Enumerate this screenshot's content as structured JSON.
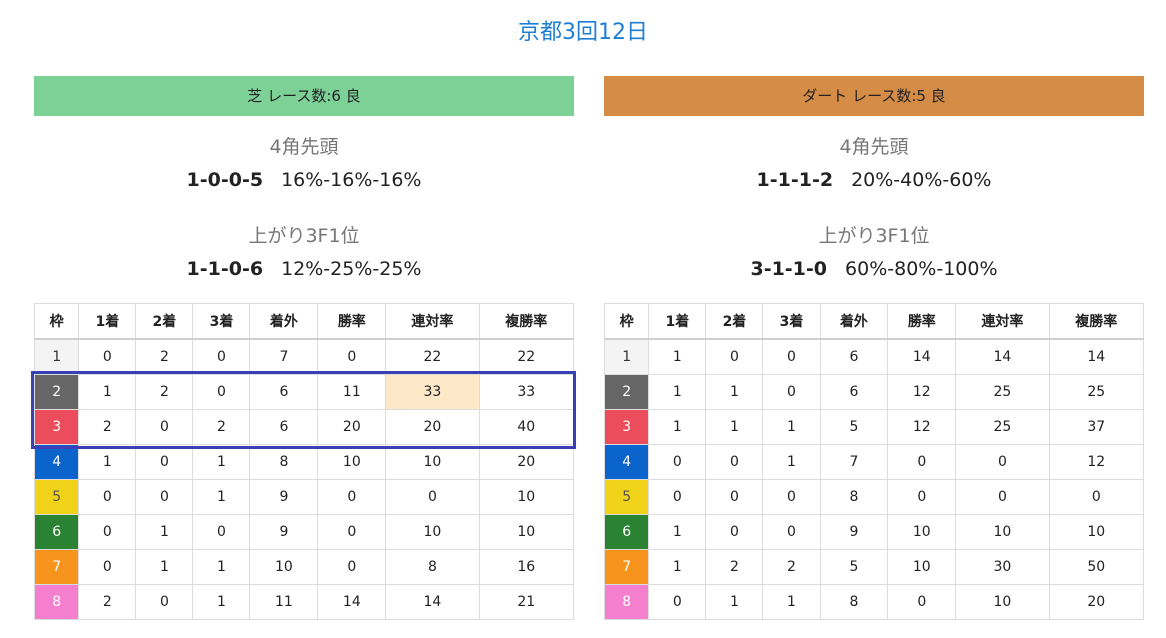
{
  "page_title": "京都3回12日",
  "colors": {
    "title": "#1e7ed4",
    "turf_banner": "#7dd197",
    "dirt_banner": "#d48c46",
    "selection_box": "#3a3fb5",
    "highlight_cell": "#fde9c7"
  },
  "waku_colors": {
    "1": {
      "bg": "#f4f4f4",
      "fg": "#333333"
    },
    "2": {
      "bg": "#666666",
      "fg": "#ffffff"
    },
    "3": {
      "bg": "#eb4d5c",
      "fg": "#ffffff"
    },
    "4": {
      "bg": "#0b63cc",
      "fg": "#ffffff"
    },
    "5": {
      "bg": "#f0d318",
      "fg": "#555555"
    },
    "6": {
      "bg": "#2a8233",
      "fg": "#ffffff"
    },
    "7": {
      "bg": "#f7941d",
      "fg": "#ffffff"
    },
    "8": {
      "bg": "#f57fcf",
      "fg": "#ffffff"
    }
  },
  "columns": [
    "枠",
    "1着",
    "2着",
    "3着",
    "着外",
    "勝率",
    "連対率",
    "複勝率"
  ],
  "turf": {
    "banner": "芝 レース数:6 良",
    "leader_label": "4角先頭",
    "leader_record": "1-0-0-5",
    "leader_rates": "16%-16%-16%",
    "last3f_label": "上がり3F1位",
    "last3f_record": "1-1-0-6",
    "last3f_rates": "12%-25%-25%",
    "rows": [
      [
        "1",
        "0",
        "2",
        "0",
        "7",
        "0",
        "22",
        "22"
      ],
      [
        "2",
        "1",
        "2",
        "0",
        "6",
        "11",
        "33",
        "33"
      ],
      [
        "3",
        "2",
        "0",
        "2",
        "6",
        "20",
        "20",
        "40"
      ],
      [
        "4",
        "1",
        "0",
        "1",
        "8",
        "10",
        "10",
        "20"
      ],
      [
        "5",
        "0",
        "0",
        "1",
        "9",
        "0",
        "0",
        "10"
      ],
      [
        "6",
        "0",
        "1",
        "0",
        "9",
        "0",
        "10",
        "10"
      ],
      [
        "7",
        "0",
        "1",
        "1",
        "10",
        "0",
        "8",
        "16"
      ],
      [
        "8",
        "2",
        "0",
        "1",
        "11",
        "14",
        "14",
        "21"
      ]
    ]
  },
  "dirt": {
    "banner": "ダート レース数:5 良",
    "leader_label": "4角先頭",
    "leader_record": "1-1-1-2",
    "leader_rates": "20%-40%-60%",
    "last3f_label": "上がり3F1位",
    "last3f_record": "3-1-1-0",
    "last3f_rates": "60%-80%-100%",
    "rows": [
      [
        "1",
        "1",
        "0",
        "0",
        "6",
        "14",
        "14",
        "14"
      ],
      [
        "2",
        "1",
        "1",
        "0",
        "6",
        "12",
        "25",
        "25"
      ],
      [
        "3",
        "1",
        "1",
        "1",
        "5",
        "12",
        "25",
        "37"
      ],
      [
        "4",
        "0",
        "0",
        "1",
        "7",
        "0",
        "0",
        "12"
      ],
      [
        "5",
        "0",
        "0",
        "0",
        "8",
        "0",
        "0",
        "0"
      ],
      [
        "6",
        "1",
        "0",
        "0",
        "9",
        "10",
        "10",
        "10"
      ],
      [
        "7",
        "1",
        "2",
        "2",
        "5",
        "10",
        "30",
        "50"
      ],
      [
        "8",
        "0",
        "1",
        "1",
        "8",
        "0",
        "10",
        "20"
      ]
    ]
  }
}
